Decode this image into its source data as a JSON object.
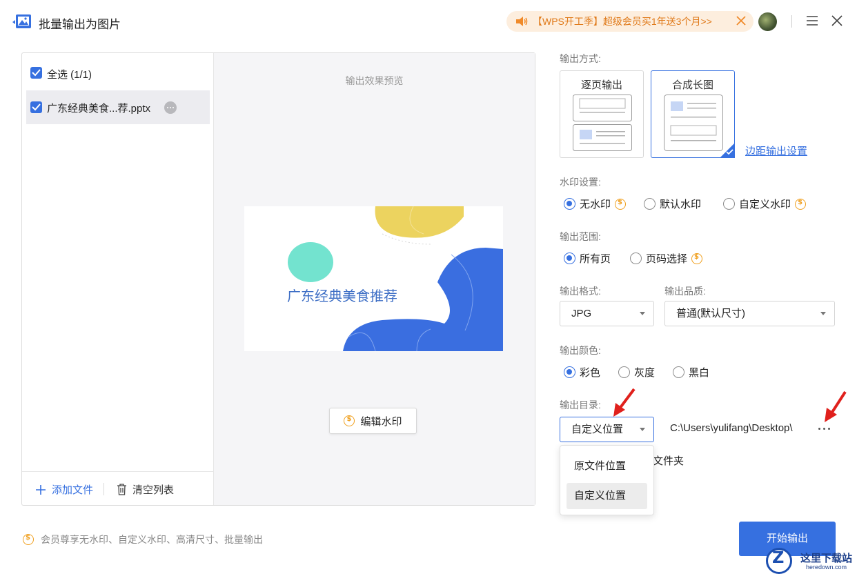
{
  "window": {
    "title": "批量输出为图片",
    "promo_text": "【WPS开工季】超级会员买1年送3个月>>"
  },
  "file_list": {
    "select_all_label": "全选 (1/1)",
    "files": [
      {
        "name": "广东经典美食...荐.pptx"
      }
    ],
    "add_file_label": "添加文件",
    "clear_list_label": "清空列表"
  },
  "preview": {
    "title": "输出效果预览",
    "slide_title": "广东经典美食推荐",
    "edit_watermark_label": "编辑水印"
  },
  "settings": {
    "output_mode_label": "输出方式:",
    "modes": [
      {
        "label": "逐页输出",
        "selected": false
      },
      {
        "label": "合成长图",
        "selected": true
      }
    ],
    "margin_link": "边距输出设置",
    "watermark_label": "水印设置:",
    "watermark_options": [
      {
        "label": "无水印",
        "selected": true,
        "premium": true
      },
      {
        "label": "默认水印",
        "selected": false,
        "premium": false
      },
      {
        "label": "自定义水印",
        "selected": false,
        "premium": true
      }
    ],
    "range_label": "输出范围:",
    "range_options": [
      {
        "label": "所有页",
        "selected": true,
        "premium": false
      },
      {
        "label": "页码选择",
        "selected": false,
        "premium": true
      }
    ],
    "format_label": "输出格式:",
    "format_value": "JPG",
    "quality_label": "输出品质:",
    "quality_value": "普通(默认尺寸)",
    "color_label": "输出颜色:",
    "color_options": [
      {
        "label": "彩色",
        "selected": true
      },
      {
        "label": "灰度",
        "selected": false
      },
      {
        "label": "黑白",
        "selected": false
      }
    ],
    "dir_label": "输出目录:",
    "dir_select_value": "自定义位置",
    "dir_path": "C:\\Users\\yulifang\\Desktop\\",
    "dir_partial_text": "文件夹",
    "dir_dropdown_options": [
      {
        "label": "原文件位置",
        "selected": false
      },
      {
        "label": "自定义位置",
        "selected": true
      }
    ]
  },
  "footer": {
    "member_note": "会员尊享无水印、自定义水印、高清尺寸、批量输出",
    "start_button": "开始输出"
  },
  "watermark_logo": {
    "cn": "这里下载站",
    "en": "heredown.com"
  },
  "colors": {
    "accent": "#3670e0",
    "premium": "#f0a020",
    "promo_text": "#e07a1a",
    "promo_bg": "#fdeede",
    "annotation_arrow": "#e0201c"
  }
}
